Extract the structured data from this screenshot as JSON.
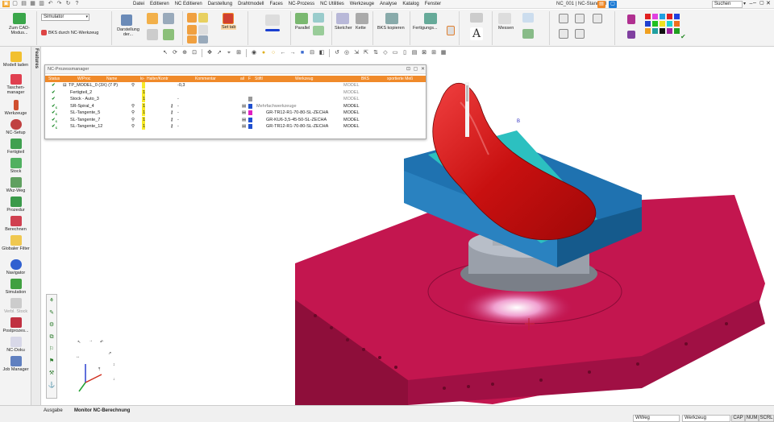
{
  "menu": [
    "Datei",
    "Editieren",
    "NC Editieren",
    "Darstellung",
    "Drahtmodell",
    "Faces",
    "NC-Prozess",
    "NC Utilities",
    "Werkzeuge",
    "Analyse",
    "Katalog",
    "Fenster"
  ],
  "window_title": "NC_001 | NC-Standard",
  "search": {
    "label": "Suchen"
  },
  "ribbon": {
    "cad_mode": "Zum CAD-Modus...",
    "simulator_combo": "Simulator",
    "bks_label": "BKS durch NC-Werkzeug",
    "darstellung": "Darstellung der...",
    "set_tab": "Set tab",
    "parallel": "Parallel",
    "sketcher": "Sketcher",
    "kette": "Kette",
    "bks_kopieren": "BKS kopieren",
    "fertigung": "Fertigungs...",
    "messen": "Messen"
  },
  "left_panel": {
    "tab_label": "Features",
    "items": [
      {
        "label": "Modell laden",
        "icon": "folder-icon"
      },
      {
        "label": "Taschen-manager",
        "icon": "pocket-icon"
      },
      {
        "label": "Werkzeuge",
        "icon": "tool-icon"
      },
      {
        "label": "NC-Setup",
        "icon": "gear-icon"
      },
      {
        "label": "Fertigteil",
        "icon": "part-icon"
      },
      {
        "label": "Stock",
        "icon": "stock-icon"
      },
      {
        "label": "Wkz-Weg",
        "icon": "toolpath-icon"
      },
      {
        "label": "Prozedur",
        "icon": "procedure-icon"
      },
      {
        "label": "Berechnen",
        "icon": "calculate-icon"
      },
      {
        "label": "Globaler Filter",
        "icon": "filter-icon"
      },
      {
        "label": "Navigator",
        "icon": "navigator-icon"
      },
      {
        "label": "Simulation",
        "icon": "simulation-icon"
      },
      {
        "label": "Verbl. Stock",
        "icon": "remaining-stock-icon"
      },
      {
        "label": "Postprozes...",
        "icon": "postprocessor-icon"
      },
      {
        "label": "NC-Doku",
        "icon": "document-icon"
      },
      {
        "label": "Job Manager",
        "icon": "job-manager-icon"
      }
    ]
  },
  "nc_dialog": {
    "title": "NC-Prozessmanager",
    "columns": [
      "Status",
      "W/Proc",
      "Name",
      "ki-",
      "Halter/Kontr",
      "",
      "Kommentar",
      "ail",
      "F",
      "Stiftl",
      "Werkzeug",
      "BKS",
      "xportierte Meß"
    ],
    "rows": [
      {
        "name": "TP_MODEL_0 (3X) (7 P)",
        "num": "",
        "comment": "-0,3",
        "werkzeug": "",
        "bks": "MODEL"
      },
      {
        "name": "Fertigteil_2",
        "num": "1",
        "comment": "",
        "werkzeug": "",
        "bks": "MODEL"
      },
      {
        "name": "Stock - Auto_3",
        "num": "1",
        "comment": "-",
        "werkzeug": "",
        "bks": "MODEL"
      },
      {
        "name": "SR-Spiral_4",
        "num": "1",
        "comment": "-",
        "werkzeug": "Mehrfachwerkzeuge",
        "bks": "MODEL"
      },
      {
        "name": "SL-Tangente_5",
        "num": "1",
        "comment": "-",
        "werkzeug": "GR-TR12-R1-70-80-SL-ZECHA",
        "bks": "MODEL"
      },
      {
        "name": "SL-Tangente_7",
        "num": "1",
        "comment": "-",
        "werkzeug": "GR-KU6-3,5-45-50-SL-ZECHA",
        "bks": "MODEL"
      },
      {
        "name": "SL-Tangente_12",
        "num": "1",
        "comment": "-",
        "werkzeug": "GR-TR12-R1-70-80-SL-ZECHA",
        "bks": "MODEL"
      }
    ]
  },
  "status": {
    "tabs": [
      "Ausgabe",
      "Monitor NC-Berechnung"
    ],
    "fields": [
      "WWeg",
      "Werkzeug"
    ],
    "indicators": [
      "CAP",
      "NUM",
      "SCRL"
    ]
  },
  "viewport": {
    "marker": "B"
  },
  "colors": {
    "accent_orange": "#f08a2a",
    "part_red": "#d11a1a",
    "fixture_blue": "#1f72b0",
    "table_crimson": "#b4114a"
  }
}
